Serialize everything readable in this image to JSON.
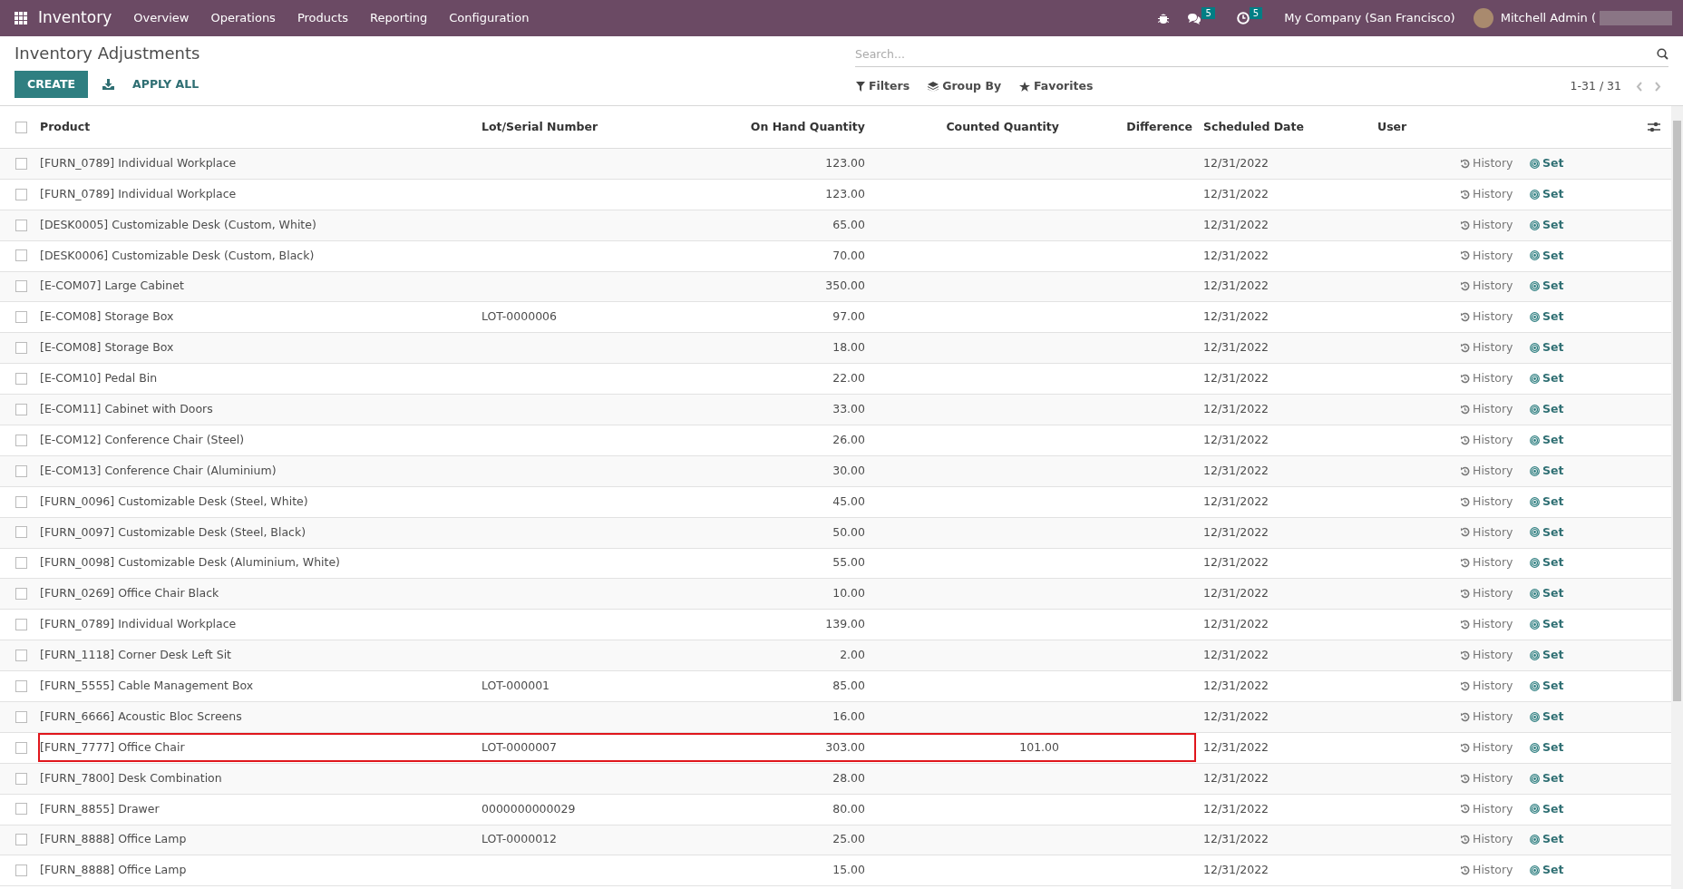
{
  "navbar": {
    "app_name": "Inventory",
    "menu": [
      "Overview",
      "Operations",
      "Products",
      "Reporting",
      "Configuration"
    ],
    "messages_count": "5",
    "activities_count": "5",
    "company": "My Company (San Francisco)",
    "user": "Mitchell Admin ("
  },
  "control_panel": {
    "title": "Inventory Adjustments",
    "create": "CREATE",
    "apply_all": "APPLY ALL",
    "search": {
      "placeholder": "Search..."
    },
    "filters": "Filters",
    "group_by": "Group By",
    "favorites": "Favorites",
    "pager": "1-31 / 31"
  },
  "table": {
    "columns": [
      "Product",
      "Lot/Serial Number",
      "On Hand Quantity",
      "Counted Quantity",
      "Difference",
      "Scheduled Date",
      "User"
    ],
    "select_all_checked": false,
    "rows": [
      {
        "checked": false,
        "product": "[FURN_0789] Individual Workplace",
        "lot": "",
        "on_hand": "123.00",
        "counted": "",
        "date": "12/31/2022",
        "history": "History",
        "set": "Set",
        "highlighted": false
      },
      {
        "checked": false,
        "product": "[FURN_0789] Individual Workplace",
        "lot": "",
        "on_hand": "123.00",
        "counted": "",
        "date": "12/31/2022",
        "history": "History",
        "set": "Set",
        "highlighted": false
      },
      {
        "checked": false,
        "product": "[DESK0005] Customizable Desk (Custom, White)",
        "lot": "",
        "on_hand": "65.00",
        "counted": "",
        "date": "12/31/2022",
        "history": "History",
        "set": "Set",
        "highlighted": false
      },
      {
        "checked": false,
        "product": "[DESK0006] Customizable Desk (Custom, Black)",
        "lot": "",
        "on_hand": "70.00",
        "counted": "",
        "date": "12/31/2022",
        "history": "History",
        "set": "Set",
        "highlighted": false
      },
      {
        "checked": false,
        "product": "[E-COM07] Large Cabinet",
        "lot": "",
        "on_hand": "350.00",
        "counted": "",
        "date": "12/31/2022",
        "history": "History",
        "set": "Set",
        "highlighted": false
      },
      {
        "checked": false,
        "product": "[E-COM08] Storage Box",
        "lot": "LOT-0000006",
        "on_hand": "97.00",
        "counted": "",
        "date": "12/31/2022",
        "history": "History",
        "set": "Set",
        "highlighted": false
      },
      {
        "checked": false,
        "product": "[E-COM08] Storage Box",
        "lot": "",
        "on_hand": "18.00",
        "counted": "",
        "date": "12/31/2022",
        "history": "History",
        "set": "Set",
        "highlighted": false
      },
      {
        "checked": false,
        "product": "[E-COM10] Pedal Bin",
        "lot": "",
        "on_hand": "22.00",
        "counted": "",
        "date": "12/31/2022",
        "history": "History",
        "set": "Set",
        "highlighted": false
      },
      {
        "checked": false,
        "product": "[E-COM11] Cabinet with Doors",
        "lot": "",
        "on_hand": "33.00",
        "counted": "",
        "date": "12/31/2022",
        "history": "History",
        "set": "Set",
        "highlighted": false
      },
      {
        "checked": false,
        "product": "[E-COM12] Conference Chair (Steel)",
        "lot": "",
        "on_hand": "26.00",
        "counted": "",
        "date": "12/31/2022",
        "history": "History",
        "set": "Set",
        "highlighted": false
      },
      {
        "checked": false,
        "product": "[E-COM13] Conference Chair (Aluminium)",
        "lot": "",
        "on_hand": "30.00",
        "counted": "",
        "date": "12/31/2022",
        "history": "History",
        "set": "Set",
        "highlighted": false
      },
      {
        "checked": false,
        "product": "[FURN_0096] Customizable Desk (Steel, White)",
        "lot": "",
        "on_hand": "45.00",
        "counted": "",
        "date": "12/31/2022",
        "history": "History",
        "set": "Set",
        "highlighted": false
      },
      {
        "checked": false,
        "product": "[FURN_0097] Customizable Desk (Steel, Black)",
        "lot": "",
        "on_hand": "50.00",
        "counted": "",
        "date": "12/31/2022",
        "history": "History",
        "set": "Set",
        "highlighted": false
      },
      {
        "checked": false,
        "product": "[FURN_0098] Customizable Desk (Aluminium, White)",
        "lot": "",
        "on_hand": "55.00",
        "counted": "",
        "date": "12/31/2022",
        "history": "History",
        "set": "Set",
        "highlighted": false
      },
      {
        "checked": false,
        "product": "[FURN_0269] Office Chair Black",
        "lot": "",
        "on_hand": "10.00",
        "counted": "",
        "date": "12/31/2022",
        "history": "History",
        "set": "Set",
        "highlighted": false
      },
      {
        "checked": false,
        "product": "[FURN_0789] Individual Workplace",
        "lot": "",
        "on_hand": "139.00",
        "counted": "",
        "date": "12/31/2022",
        "history": "History",
        "set": "Set",
        "highlighted": false
      },
      {
        "checked": false,
        "product": "[FURN_1118] Corner Desk Left Sit",
        "lot": "",
        "on_hand": "2.00",
        "counted": "",
        "date": "12/31/2022",
        "history": "History",
        "set": "Set",
        "highlighted": false
      },
      {
        "checked": false,
        "product": "[FURN_5555] Cable Management Box",
        "lot": "LOT-000001",
        "on_hand": "85.00",
        "counted": "",
        "date": "12/31/2022",
        "history": "History",
        "set": "Set",
        "highlighted": false
      },
      {
        "checked": false,
        "product": "[FURN_6666] Acoustic Bloc Screens",
        "lot": "",
        "on_hand": "16.00",
        "counted": "",
        "date": "12/31/2022",
        "history": "History",
        "set": "Set",
        "highlighted": false
      },
      {
        "checked": false,
        "product": "[FURN_7777] Office Chair",
        "lot": "LOT-0000007",
        "on_hand": "303.00",
        "counted": "101.00",
        "date": "12/31/2022",
        "history": "History",
        "set": "Set",
        "highlighted": true
      },
      {
        "checked": false,
        "product": "[FURN_7800] Desk Combination",
        "lot": "",
        "on_hand": "28.00",
        "counted": "",
        "date": "12/31/2022",
        "history": "History",
        "set": "Set",
        "highlighted": false
      },
      {
        "checked": false,
        "product": "[FURN_8855] Drawer",
        "lot": "0000000000029",
        "on_hand": "80.00",
        "counted": "",
        "date": "12/31/2022",
        "history": "History",
        "set": "Set",
        "highlighted": false
      },
      {
        "checked": false,
        "product": "[FURN_8888] Office Lamp",
        "lot": "LOT-0000012",
        "on_hand": "25.00",
        "counted": "",
        "date": "12/31/2022",
        "history": "History",
        "set": "Set",
        "highlighted": false
      },
      {
        "checked": false,
        "product": "[FURN_8888] Office Lamp",
        "lot": "",
        "on_hand": "15.00",
        "counted": "",
        "date": "12/31/2022",
        "history": "History",
        "set": "Set",
        "highlighted": false
      }
    ]
  }
}
